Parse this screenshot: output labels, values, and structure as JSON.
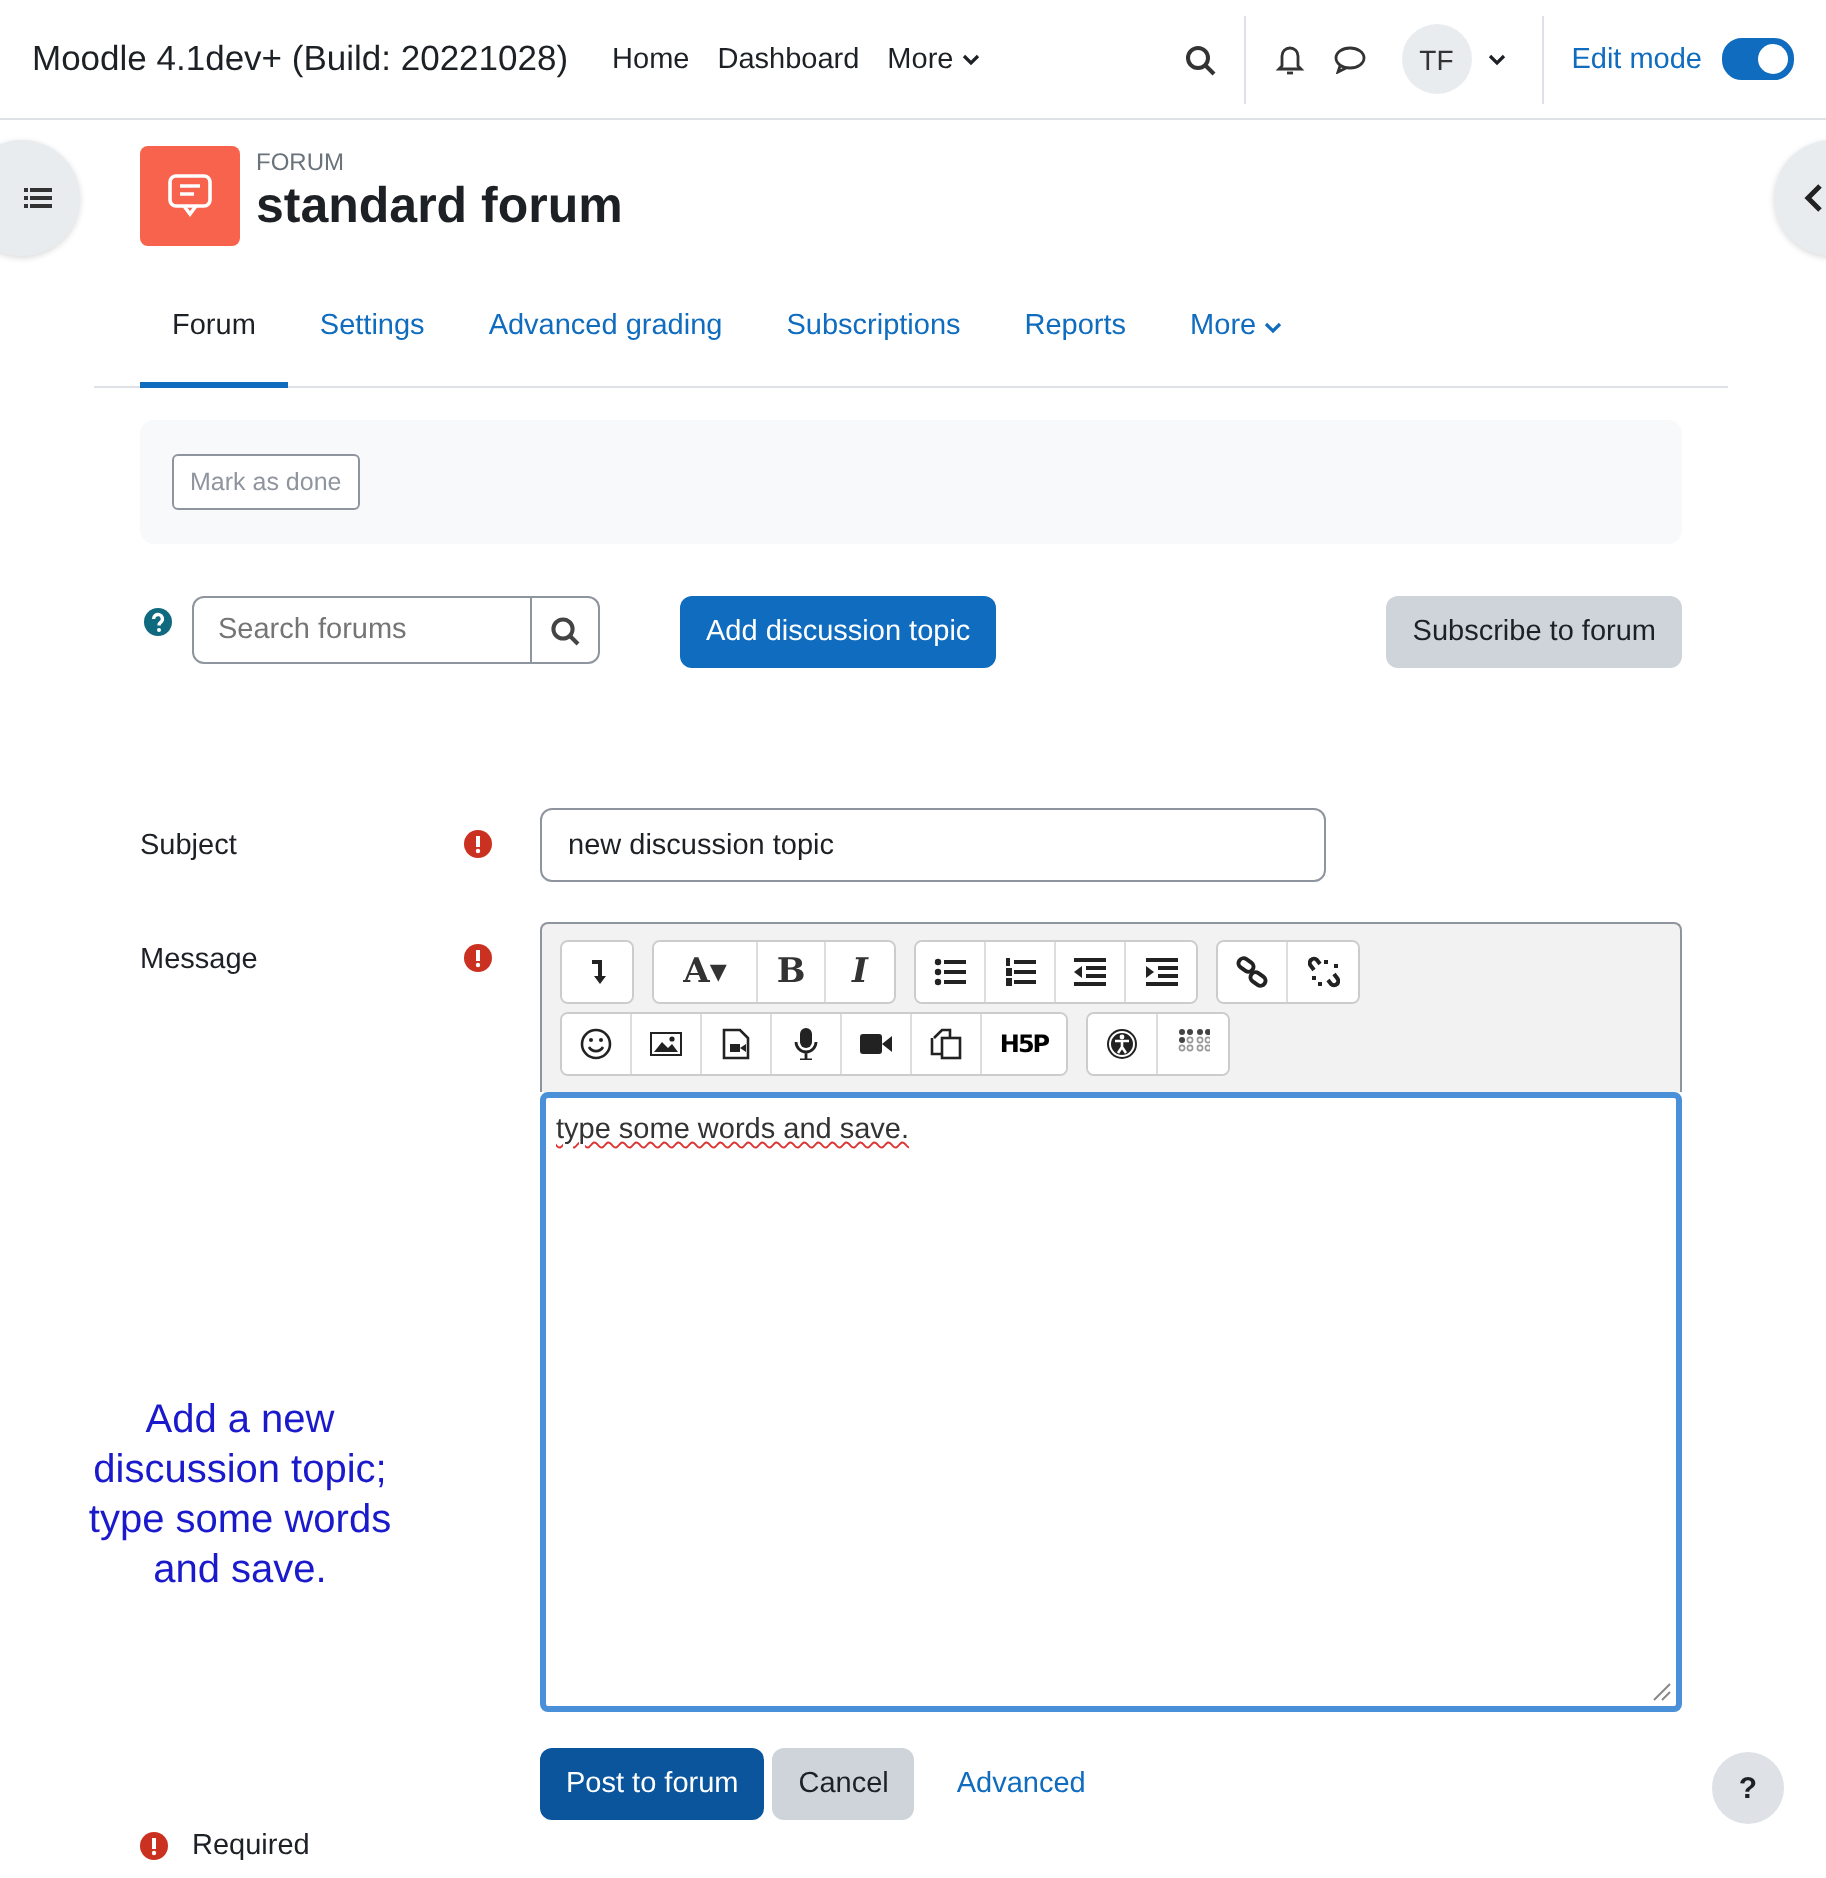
{
  "header": {
    "site_name": "Moodle 4.1dev+ (Build: 20221028)",
    "nav": [
      {
        "label": "Home",
        "kind": "link"
      },
      {
        "label": "Dashboard",
        "kind": "link"
      },
      {
        "label": "More",
        "kind": "menu"
      }
    ],
    "avatar": "TF",
    "edit_mode": {
      "label": "Edit mode",
      "on": true
    }
  },
  "page": {
    "category": "FORUM",
    "title": "standard forum"
  },
  "tabs": [
    {
      "label": "Forum",
      "selected": true,
      "kind": "link"
    },
    {
      "label": "Settings",
      "selected": false,
      "kind": "link"
    },
    {
      "label": "Advanced grading",
      "selected": false,
      "kind": "link"
    },
    {
      "label": "Subscriptions",
      "selected": false,
      "kind": "link"
    },
    {
      "label": "Reports",
      "selected": false,
      "kind": "link"
    },
    {
      "label": "More",
      "selected": false,
      "kind": "menu"
    }
  ],
  "completion": {
    "label": "Mark as done"
  },
  "actions": {
    "search_placeholder": "Search forums",
    "add": "Add discussion topic",
    "subscribe": "Subscribe to forum"
  },
  "form": {
    "fields": [
      {
        "label": "Subject",
        "required": true,
        "kind": "input",
        "value": "new discussion topic"
      },
      {
        "label": "Message",
        "required": true,
        "kind": "editor",
        "value": "type some words and save."
      }
    ]
  },
  "toolbar": [
    [
      [
        {
          "kind": "collapse"
        }
      ],
      [
        {
          "kind": "glyph",
          "glyph": "A▾"
        },
        {
          "kind": "glyph",
          "glyph": "B"
        },
        {
          "kind": "glyph",
          "glyph": "I"
        }
      ],
      [
        {
          "kind": "ul"
        },
        {
          "kind": "ol"
        },
        {
          "kind": "outdent"
        },
        {
          "kind": "indent"
        }
      ],
      [
        {
          "kind": "link"
        },
        {
          "kind": "unlink"
        }
      ]
    ],
    [
      [
        {
          "kind": "emoji"
        },
        {
          "kind": "image"
        },
        {
          "kind": "media"
        },
        {
          "kind": "mic"
        },
        {
          "kind": "video"
        },
        {
          "kind": "copy"
        },
        {
          "kind": "glyph",
          "glyph": "H5P"
        }
      ],
      [
        {
          "kind": "access"
        },
        {
          "kind": "braille"
        }
      ]
    ]
  ],
  "buttons": {
    "post": "Post to forum",
    "cancel": "Cancel",
    "advanced": "Advanced"
  },
  "required_note": "Required",
  "annotation": "Add a new discussion topic; type some words and save.",
  "help": "?"
}
